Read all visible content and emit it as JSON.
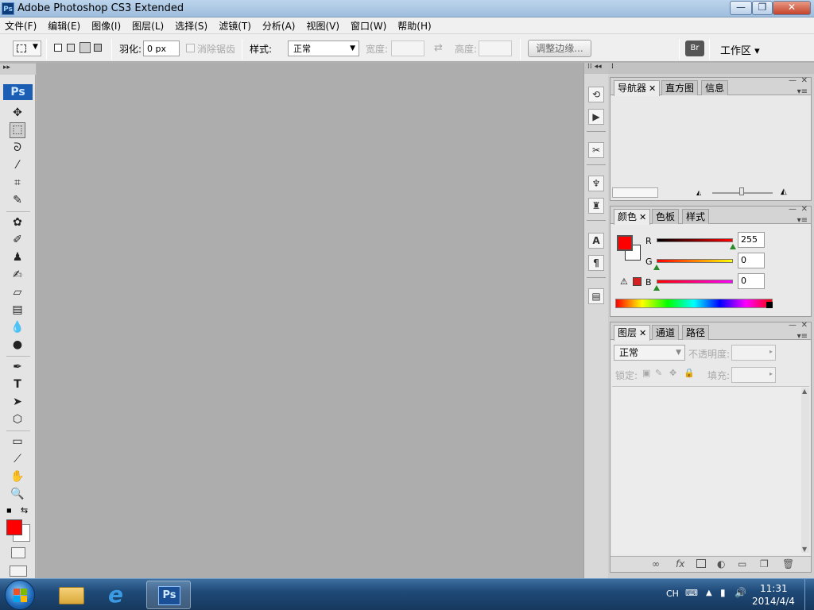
{
  "window": {
    "app_icon": "Ps",
    "title": "Adobe Photoshop CS3 Extended",
    "minimize": "—",
    "maximize": "❐",
    "close": "✕"
  },
  "menubar": {
    "items": [
      "文件(F)",
      "编辑(E)",
      "图像(I)",
      "图层(L)",
      "选择(S)",
      "滤镜(T)",
      "分析(A)",
      "视图(V)",
      "窗口(W)",
      "帮助(H)"
    ]
  },
  "options": {
    "feather_label": "羽化:",
    "feather_value": "0 px",
    "antialias_label": "消除锯齿",
    "style_label": "样式:",
    "style_value": "正常",
    "width_label": "宽度:",
    "height_label": "高度:",
    "refine_edge": "调整边缘...",
    "workspace": "工作区 ▾"
  },
  "toolbox": {
    "ps_badge": "Ps"
  },
  "navigator": {
    "tabs": [
      "导航器",
      "直方图",
      "信息"
    ]
  },
  "color": {
    "tabs": [
      "颜色",
      "色板",
      "样式"
    ],
    "r_label": "R",
    "g_label": "G",
    "b_label": "B",
    "r": "255",
    "g": "0",
    "b": "0",
    "foreground": "#ff0000"
  },
  "layers": {
    "tabs": [
      "图层",
      "通道",
      "路径"
    ],
    "blend_mode": "正常",
    "opacity_label": "不透明度:",
    "lock_label": "锁定:",
    "fill_label": "填充:"
  },
  "taskbar": {
    "lang": "CH",
    "time": "11:31",
    "date": "2014/4/4",
    "ps_label": "Ps"
  },
  "colors": {
    "accent": "#1d67b8",
    "foreground_swatch": "#ff0000",
    "canvas_bg": "#adadad"
  }
}
